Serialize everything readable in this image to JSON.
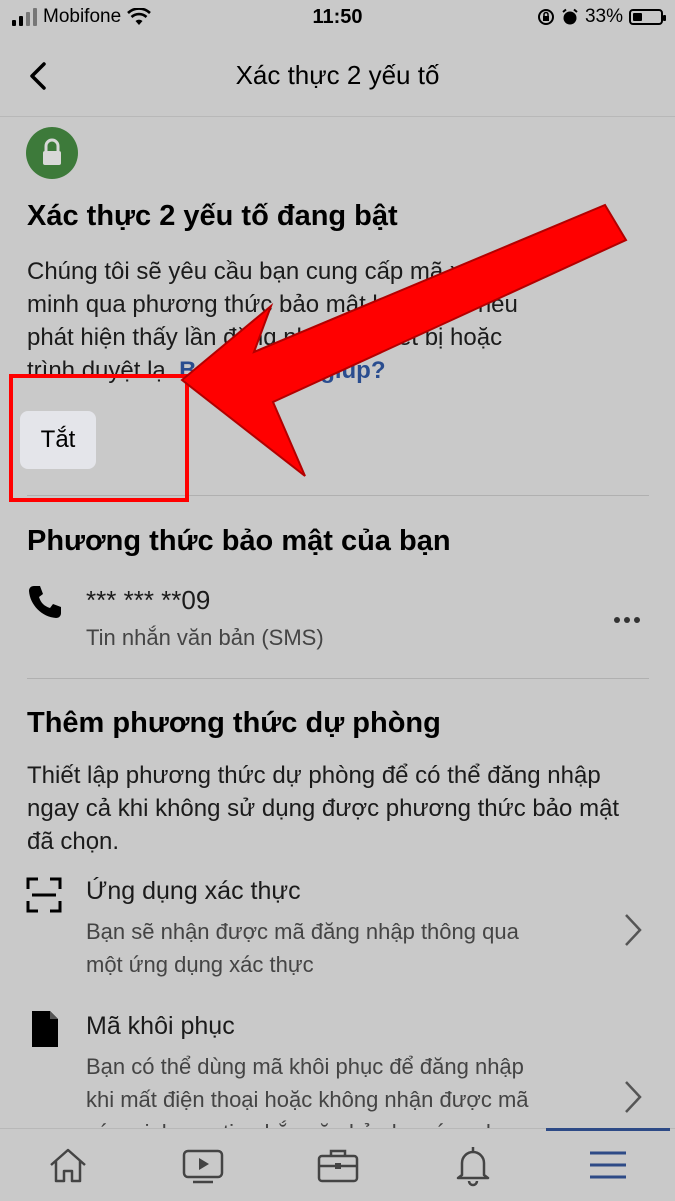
{
  "status_bar": {
    "carrier": "Mobifone",
    "time": "11:50",
    "battery": "33%",
    "battery_level": 0.33
  },
  "nav": {
    "title": "Xác thực 2 yếu tố"
  },
  "header": {
    "heading": "Xác thực 2 yếu tố đang bật",
    "desc_line1": "Chúng tôi sẽ yêu cầu bạn cung cấp mã xác",
    "desc_line2": "minh qua phương thức bảo mật bạn chọn nếu",
    "desc_line3": "phát hiện thấy lần đăng nhập từ thiết bị hoặc",
    "desc_line4_pre": "trình duyệt lạ. ",
    "desc_link": "Bạn cần trợ giúp?",
    "off_button": "Tắt"
  },
  "security_method": {
    "heading": "Phương thức bảo mật của bạn",
    "phone": "*** *** **09",
    "type": "Tin nhắn văn bản (SMS)"
  },
  "backup": {
    "heading": "Thêm phương thức dự phòng",
    "desc_line1": "Thiết lập phương thức dự phòng để có thể đăng nhập",
    "desc_line2": "ngay cả khi không sử dụng được phương thức bảo mật",
    "desc_line3": "đã chọn.",
    "items": [
      {
        "title": "Ứng dụng xác thực",
        "sub1": "Bạn sẽ nhận được mã đăng nhập thông qua",
        "sub2": "một ứng dụng xác thực",
        "icon": "scan-icon"
      },
      {
        "title": "Mã khôi phục",
        "sub1": "Bạn có thể dùng mã khôi phục để đăng nhập",
        "sub2": "khi mất điện thoại hoặc không nhận được mã",
        "sub3": "xác minh qua tin nhắn văn bản hay ứng dụng",
        "icon": "document-icon"
      }
    ]
  },
  "tabbar": {
    "tabs": [
      "home-icon",
      "video-icon",
      "briefcase-icon",
      "bell-icon",
      "menu-icon"
    ],
    "active": "menu-icon"
  },
  "colors": {
    "annotation": "#ff0000",
    "link": "#2a4d8f",
    "lock_badge": "#3d7a3a"
  }
}
